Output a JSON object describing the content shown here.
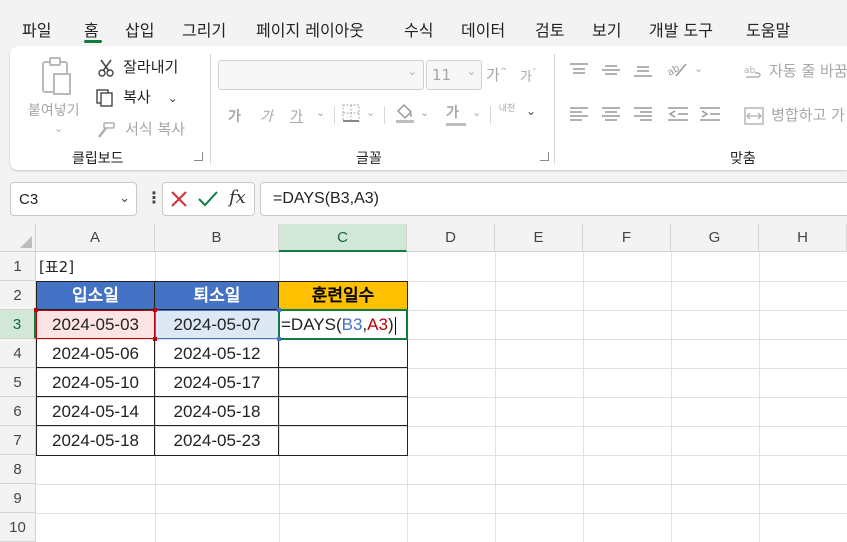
{
  "menu": {
    "tabs": [
      "파일",
      "홈",
      "삽입",
      "그리기",
      "페이지 레이아웃",
      "수식",
      "데이터",
      "검토",
      "보기",
      "개발 도구",
      "도움말"
    ],
    "active_tab": "홈"
  },
  "ribbon": {
    "clipboard": {
      "paste_label": "붙여넣기",
      "cut_label": "잘라내기",
      "copy_label": "복사",
      "format_painter_label": "서식 복사",
      "group_label": "클립보드"
    },
    "font": {
      "font_name_value": "",
      "font_size_value": "11",
      "grow_glyph": "가",
      "shrink_glyph": "가",
      "bold_glyph": "가",
      "italic_glyph": "가",
      "underline_glyph": "가",
      "font_color_glyph": "가",
      "phonetic_glyph": "내천",
      "group_label": "글꼴"
    },
    "alignment": {
      "wrap_label": "자동 줄 바꿈",
      "merge_label": "병합하고 가",
      "group_label": "맞춤"
    }
  },
  "formula_bar": {
    "name_box": "C3",
    "fx_label": "fx",
    "formula": "=DAYS(B3,A3)"
  },
  "grid": {
    "columns": [
      "A",
      "B",
      "C",
      "D",
      "E",
      "F",
      "G",
      "H"
    ],
    "rows": [
      "1",
      "2",
      "3",
      "4",
      "5",
      "6",
      "7",
      "8",
      "9",
      "10"
    ],
    "selected_column": "C",
    "selected_row": "3",
    "title_cell": "[표2]",
    "headers": [
      "입소일",
      "퇴소일",
      "훈련일수"
    ],
    "data_rows": [
      [
        "2024-05-03",
        "2024-05-07",
        "=DAYS(B3,A3)"
      ],
      [
        "2024-05-06",
        "2024-05-12",
        ""
      ],
      [
        "2024-05-10",
        "2024-05-17",
        ""
      ],
      [
        "2024-05-14",
        "2024-05-18",
        ""
      ],
      [
        "2024-05-18",
        "2024-05-23",
        ""
      ]
    ],
    "edit_formula_parts": {
      "prefix": "=DAYS(",
      "ref1": "B3",
      "comma": ",",
      "ref2": "A3",
      "suffix": ")"
    }
  },
  "colors": {
    "accent_green": "#107c41",
    "header_blue": "#4472c4",
    "header_gold": "#ffc000",
    "ref_blue": "#4472c4",
    "ref_red": "#c00000"
  }
}
